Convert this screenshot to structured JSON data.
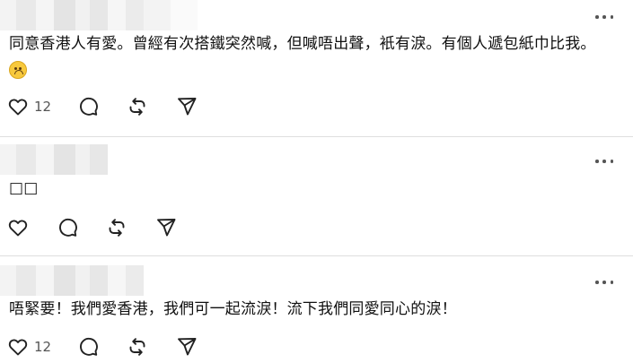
{
  "posts": [
    {
      "text_before_emoji": "同意香港人有愛。曾經有次搭鐵突然喊，但喊唔出聲，衹有淚。有個人遞包紙巾比我。",
      "emoji": "sad-face-emoji",
      "like_count": "12"
    },
    {
      "text_before_emoji": "□□",
      "like_count": ""
    },
    {
      "text_before_emoji": "唔緊要！我們愛香港，我們可一起流淚！流下我們同愛同心的淚！",
      "like_count": "12"
    }
  ],
  "icons": {
    "more": "more-horizontal-icon",
    "like": "heart-icon",
    "reply": "speech-bubble-icon",
    "repost": "repost-icon",
    "share": "paper-plane-icon"
  },
  "colors": {
    "text": "#101010",
    "icon": "#222222",
    "divider": "#dedede",
    "muted": "#555555"
  }
}
